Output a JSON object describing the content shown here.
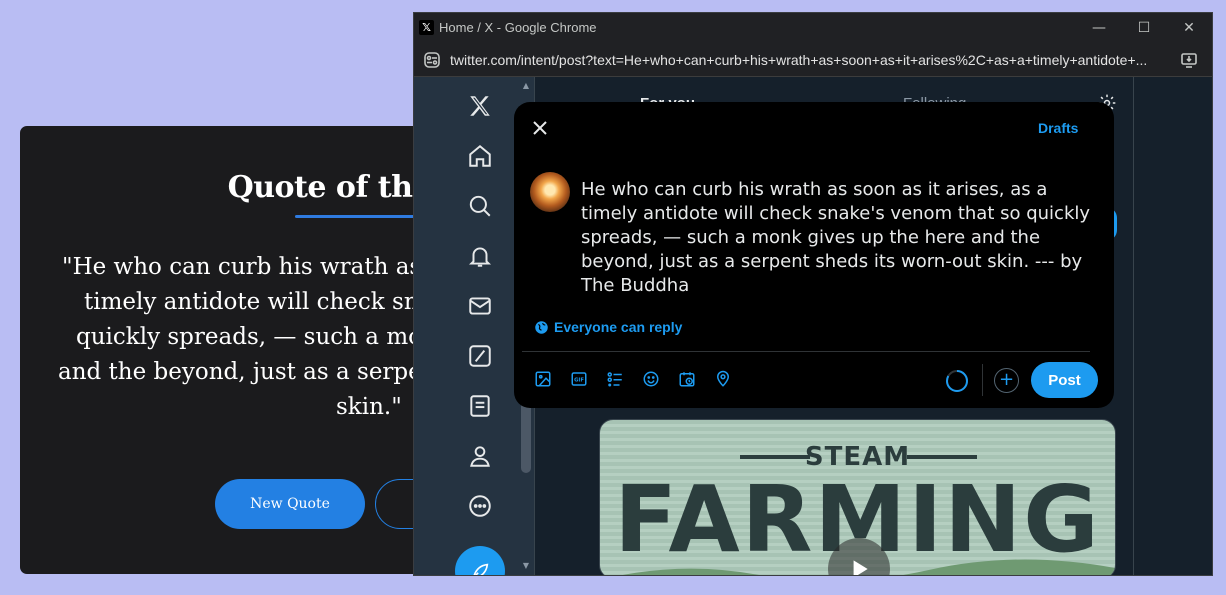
{
  "quote_app": {
    "title": "Quote of the Day",
    "quote_lines": [
      "\"He who can curb his wrath as soon as it arises, as a",
      "timely antidote will check snake's venom that so",
      "quickly spreads, — such a monk gives up the here",
      "and the beyond, just as a serpent sheds its worn-out",
      "skin.\""
    ],
    "new_quote_label": "New Quote",
    "accent_color": "#2380e3"
  },
  "browser": {
    "window_title": "Home / X - Google Chrome",
    "url": "twitter.com/intent/post?text=He+who+can+curb+his+wrath+as+soon+as+it+arises%2C+as+a+timely+antidote+...",
    "controls": {
      "minimize": "—",
      "maximize": "☐",
      "close": "✕"
    }
  },
  "x_app": {
    "logo": "𝕏",
    "nav_icons": [
      "home-icon",
      "search-icon",
      "notifications-icon",
      "messages-icon",
      "grok-icon",
      "lists-icon",
      "profile-icon",
      "more-icon"
    ],
    "tabs": [
      "For you",
      "Following"
    ],
    "media_card": {
      "top_text": "STEAM",
      "main_text": "FARMING"
    },
    "accent_color": "#1d9bf0"
  },
  "compose": {
    "drafts_label": "Drafts",
    "text_lines": [
      "He who can curb his wrath as soon as it arises, as a",
      "timely antidote will check snake's venom that so quickly",
      "spreads, — such a monk gives up the here and the",
      "beyond, just as a serpent sheds its worn-out skin. --- by",
      "The Buddha"
    ],
    "reply_setting": "Everyone can reply",
    "tool_icons": [
      "image-icon",
      "gif-icon",
      "poll-icon",
      "emoji-icon",
      "schedule-icon",
      "location-icon"
    ],
    "post_label": "Post",
    "add_label": "+"
  }
}
